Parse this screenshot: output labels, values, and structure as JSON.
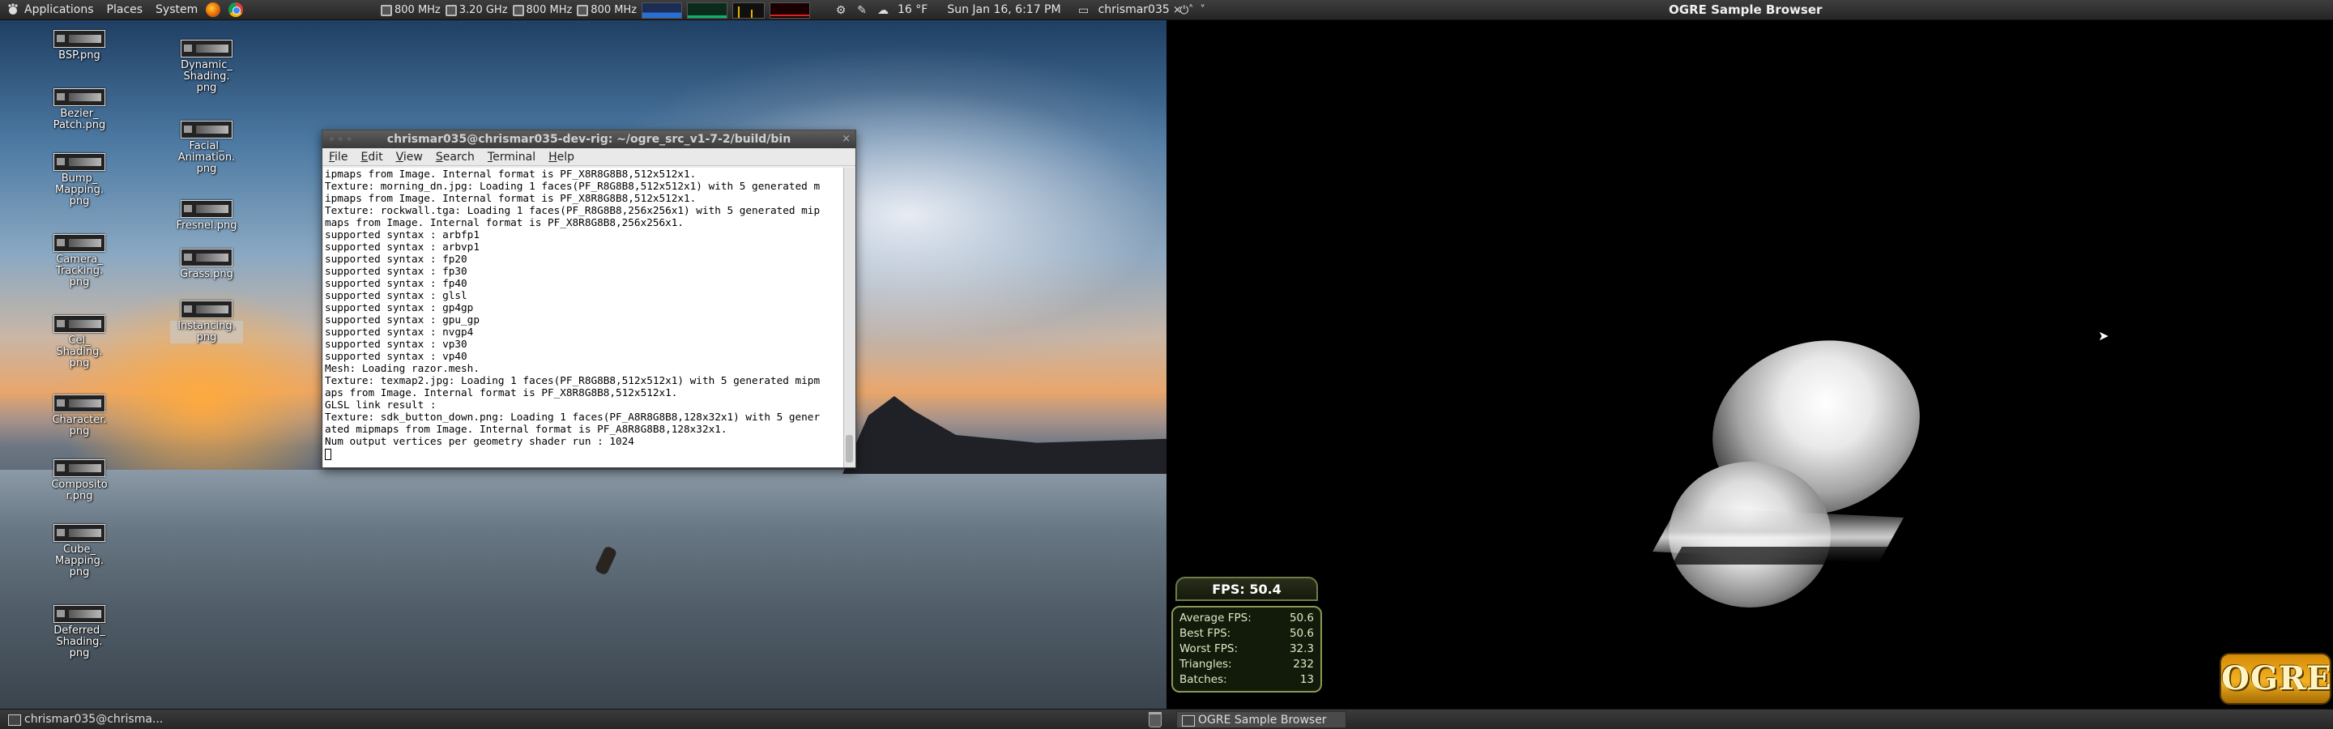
{
  "top_panel": {
    "menus": [
      "Applications",
      "Places",
      "System"
    ],
    "cpu_freqs": [
      "800 MHz",
      "3.20 GHz",
      "800 MHz",
      "800 MHz"
    ],
    "weather": "16 °F",
    "datetime": "Sun Jan 16,  6:17 PM",
    "user": "chrismar035",
    "active_window_title": "OGRE Sample Browser",
    "window_buttons": [
      "×",
      "˄",
      "˅"
    ]
  },
  "desktop": {
    "icons_col1": [
      "BSP.png",
      "Bezier_\nPatch.png",
      "Bump_\nMapping.\npng",
      "Camera_\nTracking.\npng",
      "Cel_\nShading.\npng",
      "Character.\npng",
      "Composito\nr.png",
      "Cube_\nMapping.\npng",
      "Deferred_\nShading.\npng"
    ],
    "icons_col2": [
      "Dynamic_\nShading.\npng",
      "Facial_\nAnimation.\npng",
      "Fresnel.png",
      "Grass.png",
      "Instancing.\npng"
    ]
  },
  "terminal": {
    "title": "chrismar035@chrismar035-dev-rig: ~/ogre_src_v1-7-2/build/bin",
    "menu": [
      "File",
      "Edit",
      "View",
      "Search",
      "Terminal",
      "Help"
    ],
    "lines": [
      "ipmaps from Image. Internal format is PF_X8R8G8B8,512x512x1.",
      "Texture: morning_dn.jpg: Loading 1 faces(PF_R8G8B8,512x512x1) with 5 generated m",
      "ipmaps from Image. Internal format is PF_X8R8G8B8,512x512x1.",
      "Texture: rockwall.tga: Loading 1 faces(PF_R8G8B8,256x256x1) with 5 generated mip",
      "maps from Image. Internal format is PF_X8R8G8B8,256x256x1.",
      "supported syntax : arbfp1",
      "supported syntax : arbvp1",
      "supported syntax : fp20",
      "supported syntax : fp30",
      "supported syntax : fp40",
      "supported syntax : glsl",
      "supported syntax : gp4gp",
      "supported syntax : gpu_gp",
      "supported syntax : nvgp4",
      "supported syntax : vp30",
      "supported syntax : vp40",
      "Mesh: Loading razor.mesh.",
      "Texture: texmap2.jpg: Loading 1 faces(PF_R8G8B8,512x512x1) with 5 generated mipm",
      "aps from Image. Internal format is PF_X8R8G8B8,512x512x1.",
      "GLSL link result :",
      "Texture: sdk_button_down.png: Loading 1 faces(PF_A8R8G8B8,128x32x1) with 5 gener",
      "ated mipmaps from Image. Internal format is PF_A8R8G8B8,128x32x1.",
      "Num output vertices per geometry shader run : 1024"
    ]
  },
  "stats": {
    "fps_title": "FPS: 50.4",
    "rows": [
      {
        "label": "Average FPS:",
        "value": "50.6"
      },
      {
        "label": "Best FPS:",
        "value": "50.6"
      },
      {
        "label": "Worst FPS:",
        "value": "32.3"
      },
      {
        "label": "Triangles:",
        "value": "232"
      },
      {
        "label": "Batches:",
        "value": "13"
      }
    ]
  },
  "logo_text": "OGRE",
  "bottom_panel": {
    "tasks": [
      "chrismar035@chrisma...",
      "OGRE Sample Browser"
    ]
  },
  "colors": {
    "panel": "#2e2e2e",
    "ogre_orange": "#f3b221",
    "stats_border": "#8a9a55"
  }
}
